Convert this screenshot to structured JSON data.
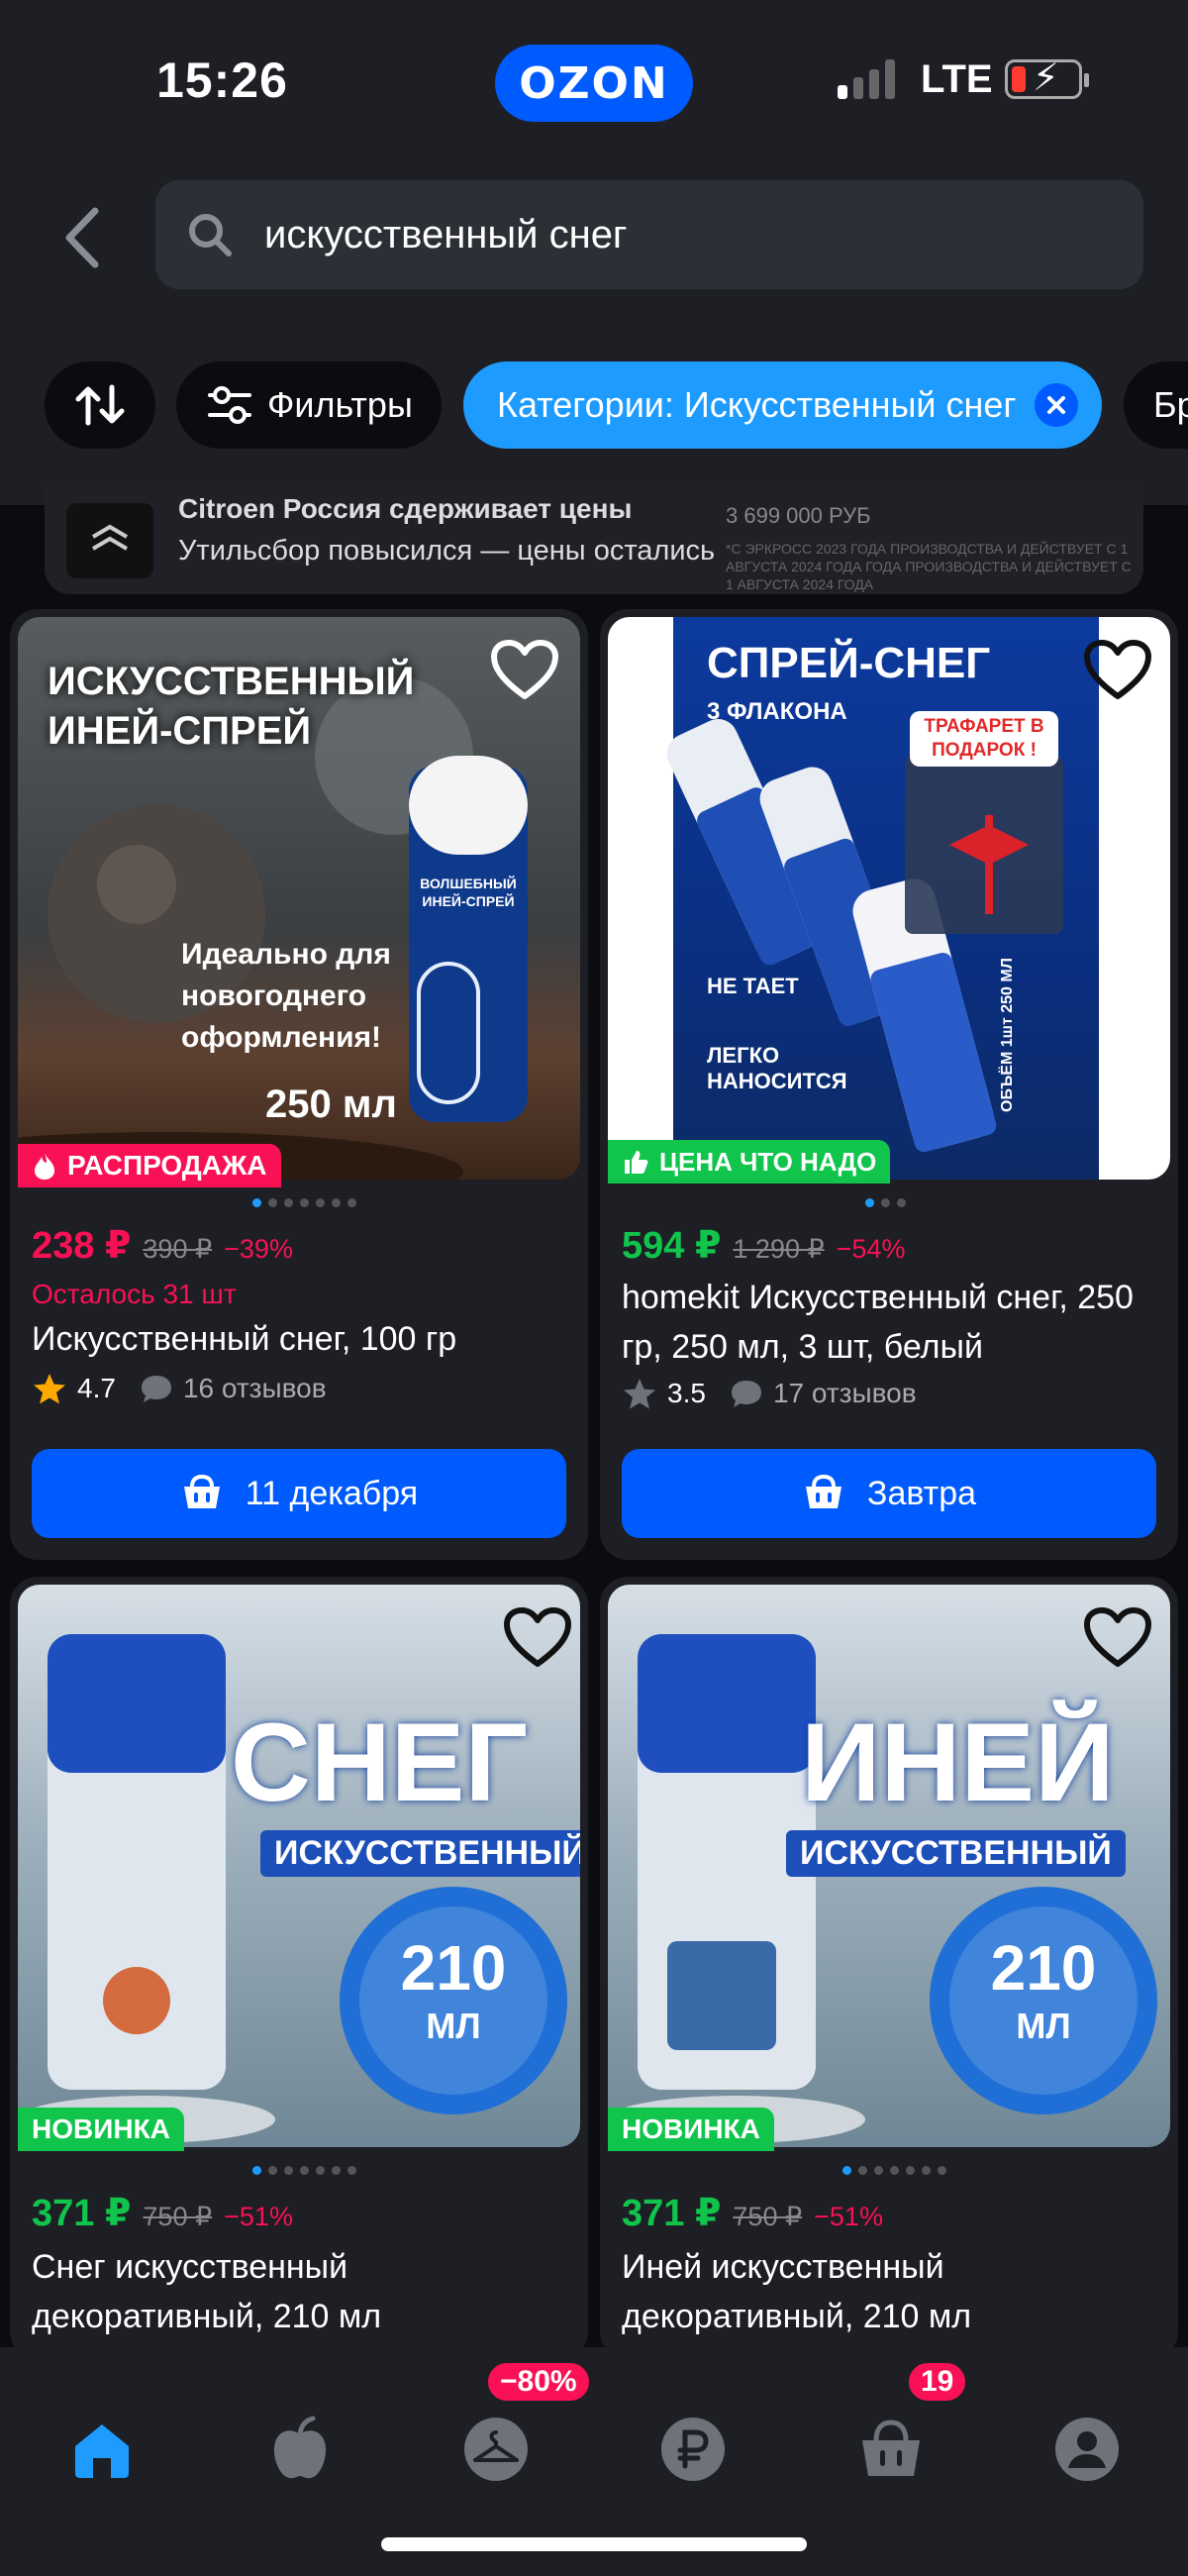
{
  "status_bar": {
    "time": "15:26",
    "brand": "OZON",
    "network": "LTE"
  },
  "search": {
    "query": "искусственный снег"
  },
  "chips": {
    "filters_label": "Фильтры",
    "category_label": "Категории: Искусственный снег",
    "next_label": "Бр"
  },
  "banner": {
    "line1": "Citroen Россия сдерживает цены",
    "line2": "Утильсбор повысился — цены остались",
    "price_text": "3 699 000 РУБ",
    "fine_text": "*С ЭРКРОСС 2023 ГОДА ПРОИЗВОДСТВА И ДЕЙСТВУЕТ С 1 АВГУСТА 2024 ГОДА ГОДА ПРОИЗВОДСТВА И ДЕЙСТВУЕТ С 1 АВГУСТА 2024 ГОДА"
  },
  "products": [
    {
      "image_text_top": "ИСКУССТВЕННЫЙ ИНЕЙ-СПРЕЙ",
      "image_text_mid": "Идеально для новогоднего оформления!",
      "image_text_volume": "250 мл",
      "can_label": "ВОЛШЕБНЫЙ ИНЕЙ-СПРЕЙ",
      "badge": "РАСПРОДАЖА",
      "price": "238 ₽",
      "old_price": "390 ₽",
      "discount": "−39%",
      "stock": "Осталось 31 шт",
      "title": "Искусственный снег, 100 гр",
      "rating": "4.7",
      "reviews": "16 отзывов",
      "delivery": "11 декабря"
    },
    {
      "image_text_top": "СПРЕЙ-СНЕГ",
      "image_text_sub": "3 ФЛАКОНА",
      "image_text_gift": "ТРАФАРЕТ В ПОДАРОК !",
      "image_text_a": "НЕ ТАЕТ",
      "image_text_b": "ЛЕГКО НАНОСИТСЯ",
      "image_text_side": "ОБЪЁМ 1шт 250 МЛ",
      "badge": "ЦЕНА ЧТО НАДО",
      "price": "594 ₽",
      "old_price": "1 290 ₽",
      "discount": "−54%",
      "title": "homekit Искусственный снег, 250 гр, 250 мл, 3 шт, белый",
      "rating": "3.5",
      "reviews": "17 отзывов",
      "delivery": "Завтра"
    },
    {
      "image_text_big": "СНЕГ",
      "image_text_sub": "ИСКУССТВЕННЫЙ",
      "image_text_volume_num": "210",
      "image_text_volume_unit": "МЛ",
      "badge": "НОВИНКА",
      "price": "371 ₽",
      "old_price": "750 ₽",
      "discount": "−51%",
      "title": "Снег искусственный декоративный, 210 мл"
    },
    {
      "image_text_big": "ИНЕЙ",
      "image_text_sub": "ИСКУССТВЕННЫЙ",
      "image_text_volume_num": "210",
      "image_text_volume_unit": "МЛ",
      "badge": "НОВИНКА",
      "price": "371 ₽",
      "old_price": "750 ₽",
      "discount": "−51%",
      "title": "Иней искусственный декоративный, 210 мл"
    }
  ],
  "nav": {
    "sale_badge": "−80%",
    "cart_count": "19"
  },
  "colors": {
    "accent": "#005bff",
    "category_chip": "#1e9bff",
    "sale_red": "#f91155",
    "price_green": "#10c44c"
  }
}
